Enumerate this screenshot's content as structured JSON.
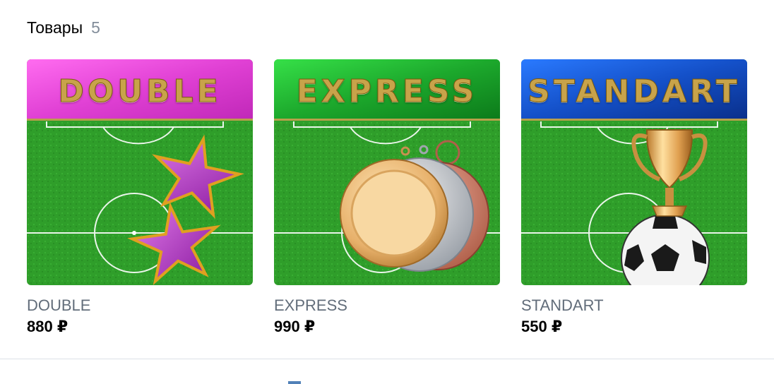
{
  "section": {
    "title": "Товары",
    "count": "5"
  },
  "products": [
    {
      "band_text": "DOUBLE",
      "name": "DOUBLE",
      "price": "880 ₽",
      "band_color": "#e44bd6",
      "icon": "stars-icon"
    },
    {
      "band_text": "EXPRESS",
      "name": "EXPRESS",
      "price": "990 ₽",
      "band_color": "#1fae2e",
      "icon": "medals-icon"
    },
    {
      "band_text": "STANDART",
      "name": "STANDART",
      "price": "550 ₽",
      "band_color": "#1450c8",
      "icon": "trophy-ball-icon"
    }
  ]
}
